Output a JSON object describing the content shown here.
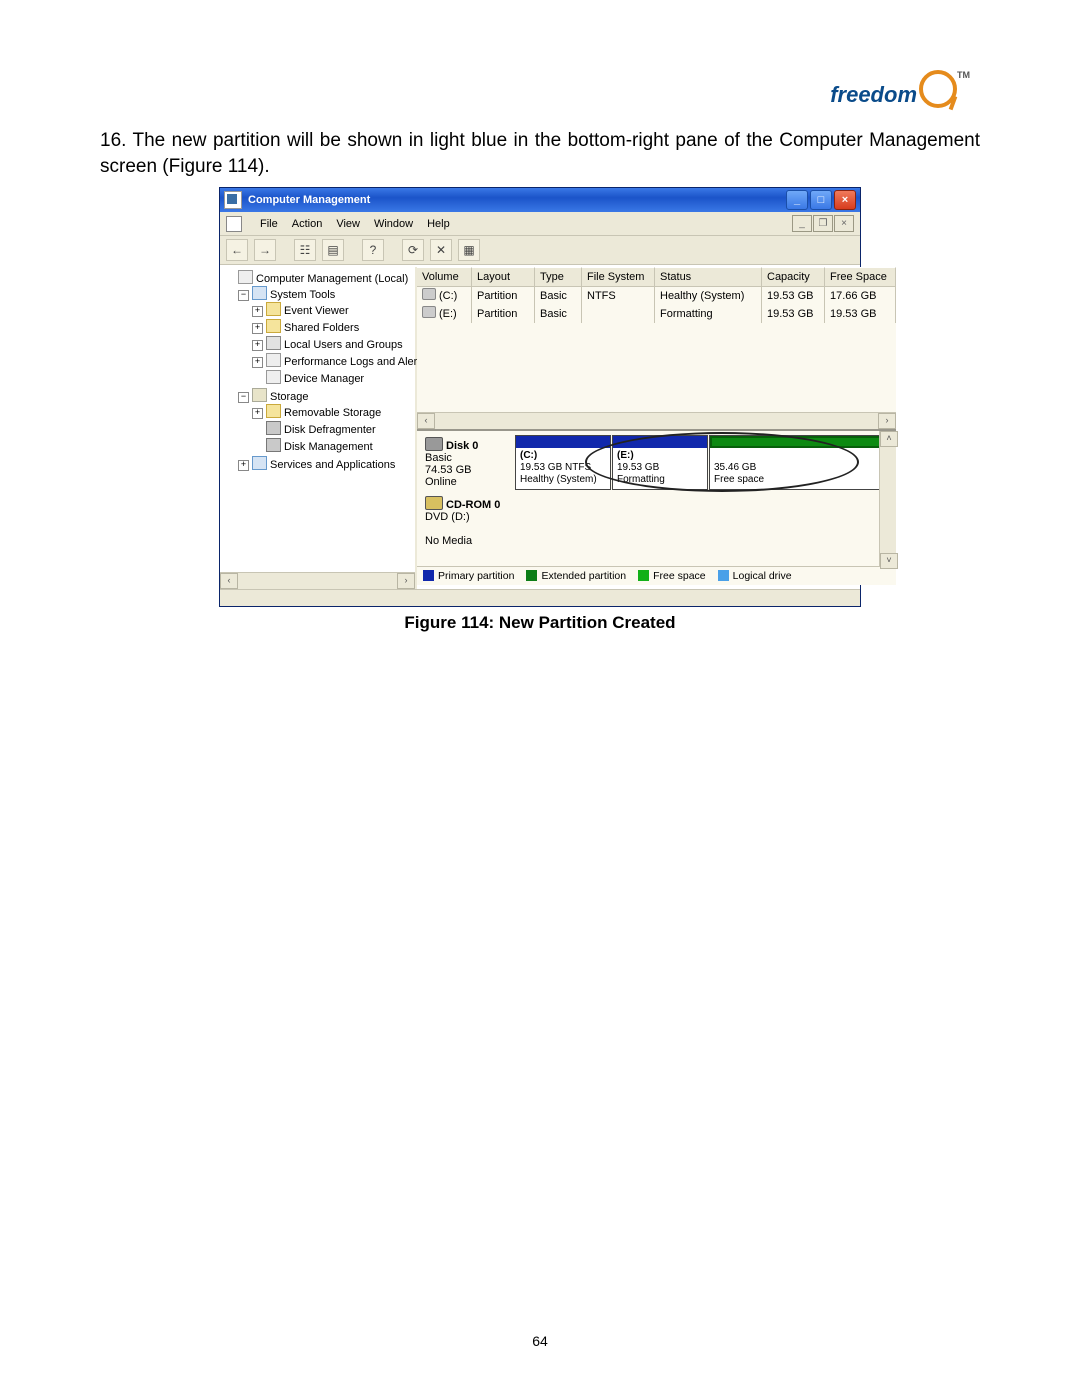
{
  "page_number": "64",
  "logo_text": "freedom",
  "logo_tm": "TM",
  "step_text": "16. The new partition will be shown in light blue in the bottom-right pane of the Computer Management screen (Figure 114).",
  "caption": "Figure 114: New Partition Created",
  "window": {
    "title": "Computer Management",
    "menus": [
      "File",
      "Action",
      "View",
      "Window",
      "Help"
    ]
  },
  "tree": {
    "root": "Computer Management (Local)",
    "system_tools": "System Tools",
    "event_viewer": "Event Viewer",
    "shared_folders": "Shared Folders",
    "local_users": "Local Users and Groups",
    "perf_logs": "Performance Logs and Alerts",
    "device_mgr": "Device Manager",
    "storage": "Storage",
    "removable": "Removable Storage",
    "defrag": "Disk Defragmenter",
    "diskmgmt": "Disk Management",
    "services": "Services and Applications"
  },
  "columns": {
    "volume": "Volume",
    "layout": "Layout",
    "type": "Type",
    "fs": "File System",
    "status": "Status",
    "capacity": "Capacity",
    "free": "Free Space"
  },
  "rows": [
    {
      "vol": "(C:)",
      "layout": "Partition",
      "type": "Basic",
      "fs": "NTFS",
      "status": "Healthy (System)",
      "cap": "19.53 GB",
      "free": "17.66 GB"
    },
    {
      "vol": "(E:)",
      "layout": "Partition",
      "type": "Basic",
      "fs": "",
      "status": "Formatting",
      "cap": "19.53 GB",
      "free": "19.53 GB"
    }
  ],
  "disk0": {
    "title": "Disk 0",
    "type": "Basic",
    "size": "74.53 GB",
    "state": "Online",
    "c_label": "(C:)",
    "c_size": "19.53 GB NTFS",
    "c_status": "Healthy (System)",
    "e_label": "(E:)",
    "e_size": "19.53 GB",
    "e_status": "Formatting",
    "free_size": "35.46 GB",
    "free_status": "Free space"
  },
  "cdrom": {
    "title": "CD-ROM 0",
    "type": "DVD (D:)",
    "state": "No Media"
  },
  "legend": {
    "primary": "Primary partition",
    "extended": "Extended partition",
    "free": "Free space",
    "logical": "Logical drive"
  }
}
